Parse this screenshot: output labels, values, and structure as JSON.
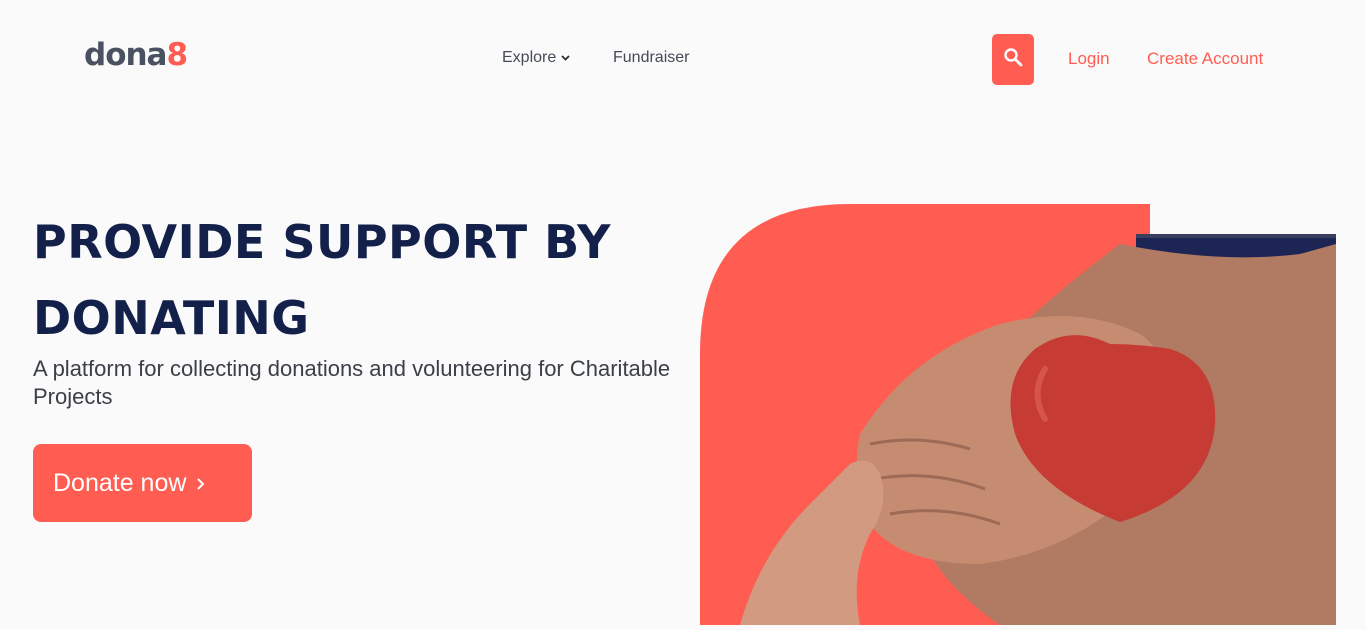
{
  "brand": {
    "logo_main": "dona",
    "logo_accent": "8"
  },
  "nav": {
    "explore_label": "Explore",
    "fundraiser_label": "Fundraiser"
  },
  "header": {
    "login_label": "Login",
    "create_account_label": "Create Account"
  },
  "hero": {
    "title": "PROVIDE SUPPORT BY DONATING",
    "subtitle": "A platform for collecting donations and volunteering for Charitable Projects",
    "cta_label": "Donate now",
    "cta_icon": "chevron-right-icon"
  },
  "colors": {
    "accent": "#ff5d52",
    "navy": "#13204a",
    "text": "#3b3f46",
    "background": "#fafafa"
  },
  "icons": {
    "search": "search-icon",
    "explore_caret": "chevron-down-icon"
  }
}
